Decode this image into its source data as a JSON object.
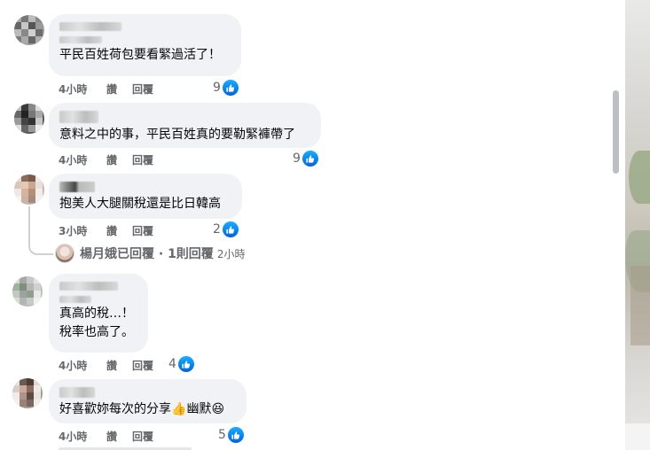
{
  "comments": [
    {
      "text": "平民百姓荷包要看緊過活了！",
      "time": "4小時",
      "like_label": "讚",
      "reply_label": "回覆",
      "reactions": "9"
    },
    {
      "text": "意料之中的事，平民百姓真的要勒緊褲帶了",
      "time": "4小時",
      "like_label": "讚",
      "reply_label": "回覆",
      "reactions": "9"
    },
    {
      "text": "抱美人大腿關稅還是比日韓高",
      "time": "3小時",
      "like_label": "讚",
      "reply_label": "回覆",
      "reactions": "2",
      "replies": {
        "summary": "楊月娥已回覆 · 1則回覆",
        "time": "2小時"
      }
    },
    {
      "text": "真高的稅…！\n稅率也高了。",
      "time": "4小時",
      "like_label": "讚",
      "reply_label": "回覆",
      "reactions": "4"
    },
    {
      "text": "好喜歡妳每次的分享",
      "emoji_1": "👍",
      "text_2": "幽默",
      "emoji_2": "😆",
      "time": "4小時",
      "like_label": "讚",
      "reply_label": "回覆",
      "reactions": "5"
    }
  ],
  "colors": {
    "bubble": "#f0f2f5",
    "meta": "#65676b",
    "like_blue": "#0866ff"
  },
  "icons": [
    "like-icon",
    "avatar-blurred"
  ]
}
